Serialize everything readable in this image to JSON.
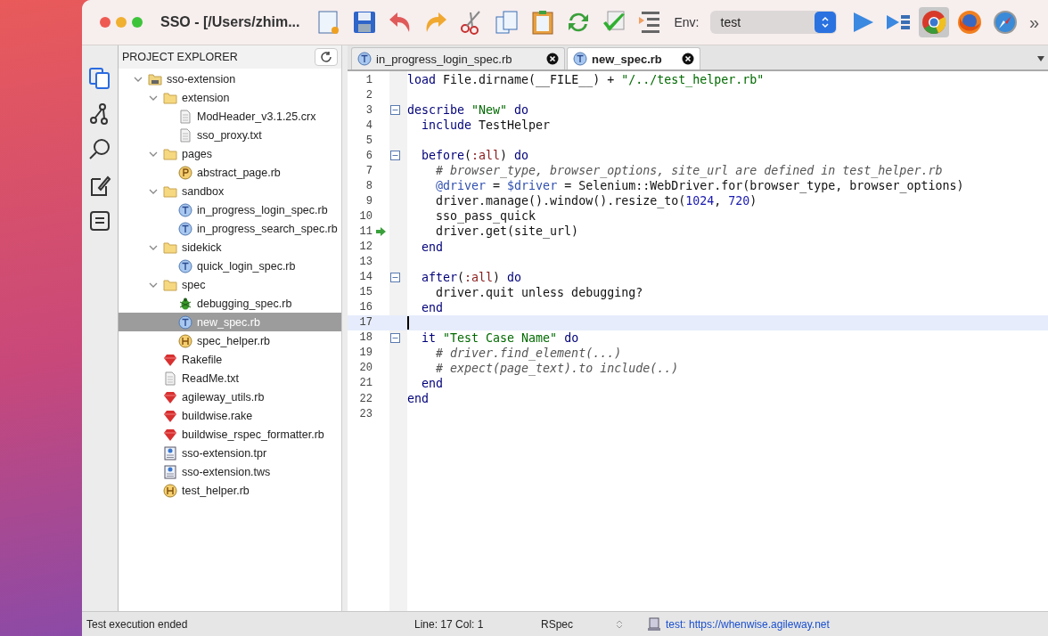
{
  "window": {
    "title": "SSO - [/Users/zhim..."
  },
  "toolbar": {
    "env_label": "Env:",
    "env_value": "test",
    "overflow": "»"
  },
  "sidebar": {
    "items": [
      {
        "kind": "files",
        "selected": true
      },
      {
        "kind": "branch",
        "selected": false
      },
      {
        "kind": "search",
        "selected": false
      },
      {
        "kind": "edit",
        "selected": false
      },
      {
        "kind": "notes",
        "selected": false
      }
    ]
  },
  "explorer": {
    "title": "PROJECT EXPLORER",
    "tree": [
      {
        "label": "sso-extension",
        "kind": "project",
        "expanded": true,
        "selected": false,
        "children": [
          {
            "label": "extension",
            "kind": "folder",
            "expanded": true,
            "selected": false,
            "children": [
              {
                "label": "ModHeader_v3.1.25.crx",
                "kind": "doc",
                "selected": false
              },
              {
                "label": "sso_proxy.txt",
                "kind": "doc",
                "selected": false
              }
            ]
          },
          {
            "label": "pages",
            "kind": "folder",
            "expanded": true,
            "selected": false,
            "children": [
              {
                "label": "abstract_page.rb",
                "kind": "page",
                "selected": false
              }
            ]
          },
          {
            "label": "sandbox",
            "kind": "folder",
            "expanded": true,
            "selected": false,
            "children": [
              {
                "label": "in_progress_login_spec.rb",
                "kind": "test",
                "selected": false
              },
              {
                "label": "in_progress_search_spec.rb",
                "kind": "test",
                "selected": false
              }
            ]
          },
          {
            "label": "sidekick",
            "kind": "folder",
            "expanded": true,
            "selected": false,
            "children": [
              {
                "label": "quick_login_spec.rb",
                "kind": "test",
                "selected": false
              }
            ]
          },
          {
            "label": "spec",
            "kind": "folder",
            "expanded": true,
            "selected": false,
            "children": [
              {
                "label": "debugging_spec.rb",
                "kind": "bug",
                "selected": false
              },
              {
                "label": "new_spec.rb",
                "kind": "test",
                "selected": true
              },
              {
                "label": "spec_helper.rb",
                "kind": "helper",
                "selected": false
              }
            ]
          },
          {
            "label": "Rakefile",
            "kind": "gem",
            "selected": false
          },
          {
            "label": "ReadMe.txt",
            "kind": "doc",
            "selected": false
          },
          {
            "label": "agileway_utils.rb",
            "kind": "gem",
            "selected": false
          },
          {
            "label": "buildwise.rake",
            "kind": "gem",
            "selected": false
          },
          {
            "label": "buildwise_rspec_formatter.rb",
            "kind": "gem",
            "selected": false
          },
          {
            "label": "sso-extension.tpr",
            "kind": "project-file",
            "selected": false
          },
          {
            "label": "sso-extension.tws",
            "kind": "project-file",
            "selected": false
          },
          {
            "label": "test_helper.rb",
            "kind": "helper",
            "selected": false
          }
        ]
      }
    ]
  },
  "tabs": [
    {
      "label": "in_progress_login_spec.rb",
      "selected": false
    },
    {
      "label": "new_spec.rb",
      "selected": true
    }
  ],
  "editor": {
    "lines": [
      {
        "number": "1",
        "fold": false,
        "current": false,
        "executing": false,
        "tokens": [
          {
            "kind": "keyword",
            "text": "load"
          },
          {
            "kind": "plain",
            "text": " File.dirname(__FILE__) + "
          },
          {
            "kind": "string",
            "text": "\"/../test_helper.rb\""
          }
        ]
      },
      {
        "number": "2",
        "fold": false,
        "current": false,
        "executing": false
      },
      {
        "number": "3",
        "fold": true,
        "current": false,
        "executing": false,
        "tokens": [
          {
            "kind": "keyword",
            "text": "describe"
          },
          {
            "kind": "string",
            "text": " \"New\""
          },
          {
            "kind": "keyword",
            "text": " do"
          }
        ]
      },
      {
        "number": "4",
        "fold": false,
        "current": false,
        "executing": false,
        "tokens": [
          {
            "kind": "keyword",
            "text": "  include"
          },
          {
            "kind": "plain",
            "text": " TestHelper"
          }
        ]
      },
      {
        "number": "5",
        "fold": false,
        "current": false,
        "executing": false
      },
      {
        "number": "6",
        "fold": true,
        "current": false,
        "executing": false,
        "tokens": [
          {
            "kind": "keyword",
            "text": "  before"
          },
          {
            "kind": "plain",
            "text": "("
          },
          {
            "kind": "symbol",
            "text": ":all"
          },
          {
            "kind": "plain",
            "text": ")"
          },
          {
            "kind": "keyword",
            "text": " do"
          }
        ]
      },
      {
        "number": "7",
        "fold": false,
        "current": false,
        "executing": false,
        "tokens": [
          {
            "kind": "comment",
            "text": "    # browser_type, browser_options, site_url are defined in test_helper.rb"
          }
        ]
      },
      {
        "number": "8",
        "fold": false,
        "current": false,
        "executing": false,
        "tokens": [
          {
            "kind": "variable",
            "text": "    @driver"
          },
          {
            "kind": "plain",
            "text": " = "
          },
          {
            "kind": "variable",
            "text": "$driver"
          },
          {
            "kind": "plain",
            "text": " = Selenium::WebDriver.for(browser_type, browser_options)"
          }
        ]
      },
      {
        "number": "9",
        "fold": false,
        "current": false,
        "executing": false,
        "tokens": [
          {
            "kind": "plain",
            "text": "    driver.manage().window().resize_to("
          },
          {
            "kind": "number",
            "text": "1024"
          },
          {
            "kind": "plain",
            "text": ", "
          },
          {
            "kind": "number",
            "text": "720"
          },
          {
            "kind": "plain",
            "text": ")"
          }
        ]
      },
      {
        "number": "10",
        "fold": false,
        "current": false,
        "executing": false,
        "tokens": [
          {
            "kind": "plain",
            "text": "    sso_pass_quick"
          }
        ]
      },
      {
        "number": "11",
        "fold": false,
        "current": false,
        "executing": true,
        "tokens": [
          {
            "kind": "plain",
            "text": "    driver.get(site_url)"
          }
        ]
      },
      {
        "number": "12",
        "fold": false,
        "current": false,
        "executing": false,
        "tokens": [
          {
            "kind": "keyword",
            "text": "  end"
          }
        ]
      },
      {
        "number": "13",
        "fold": false,
        "current": false,
        "executing": false
      },
      {
        "number": "14",
        "fold": true,
        "current": false,
        "executing": false,
        "tokens": [
          {
            "kind": "keyword",
            "text": "  after"
          },
          {
            "kind": "plain",
            "text": "("
          },
          {
            "kind": "symbol",
            "text": ":all"
          },
          {
            "kind": "plain",
            "text": ")"
          },
          {
            "kind": "keyword",
            "text": " do"
          }
        ]
      },
      {
        "number": "15",
        "fold": false,
        "current": false,
        "executing": false,
        "tokens": [
          {
            "kind": "plain",
            "text": "    driver.quit unless debugging?"
          }
        ]
      },
      {
        "number": "16",
        "fold": false,
        "current": false,
        "executing": false,
        "tokens": [
          {
            "kind": "keyword",
            "text": "  end"
          }
        ]
      },
      {
        "number": "17",
        "fold": false,
        "current": true,
        "executing": false
      },
      {
        "number": "18",
        "fold": true,
        "current": false,
        "executing": false,
        "tokens": [
          {
            "kind": "keyword",
            "text": "  it"
          },
          {
            "kind": "string",
            "text": " \"Test Case Name\""
          },
          {
            "kind": "keyword",
            "text": " do"
          }
        ]
      },
      {
        "number": "19",
        "fold": false,
        "current": false,
        "executing": false,
        "tokens": [
          {
            "kind": "comment",
            "text": "    # driver.find_element(...)"
          }
        ]
      },
      {
        "number": "20",
        "fold": false,
        "current": false,
        "executing": false,
        "tokens": [
          {
            "kind": "comment",
            "text": "    # expect(page_text).to include(..)"
          }
        ]
      },
      {
        "number": "21",
        "fold": false,
        "current": false,
        "executing": false,
        "tokens": [
          {
            "kind": "keyword",
            "text": "  end"
          }
        ]
      },
      {
        "number": "22",
        "fold": false,
        "current": false,
        "executing": false,
        "tokens": [
          {
            "kind": "keyword",
            "text": "end"
          }
        ]
      },
      {
        "number": "23",
        "fold": false,
        "current": false,
        "executing": false
      }
    ]
  },
  "status_bar": {
    "message": "Test execution ended",
    "position": "Line: 17  Col: 1",
    "mode": "RSpec",
    "server": "test: https://whenwise.agileway.net"
  }
}
